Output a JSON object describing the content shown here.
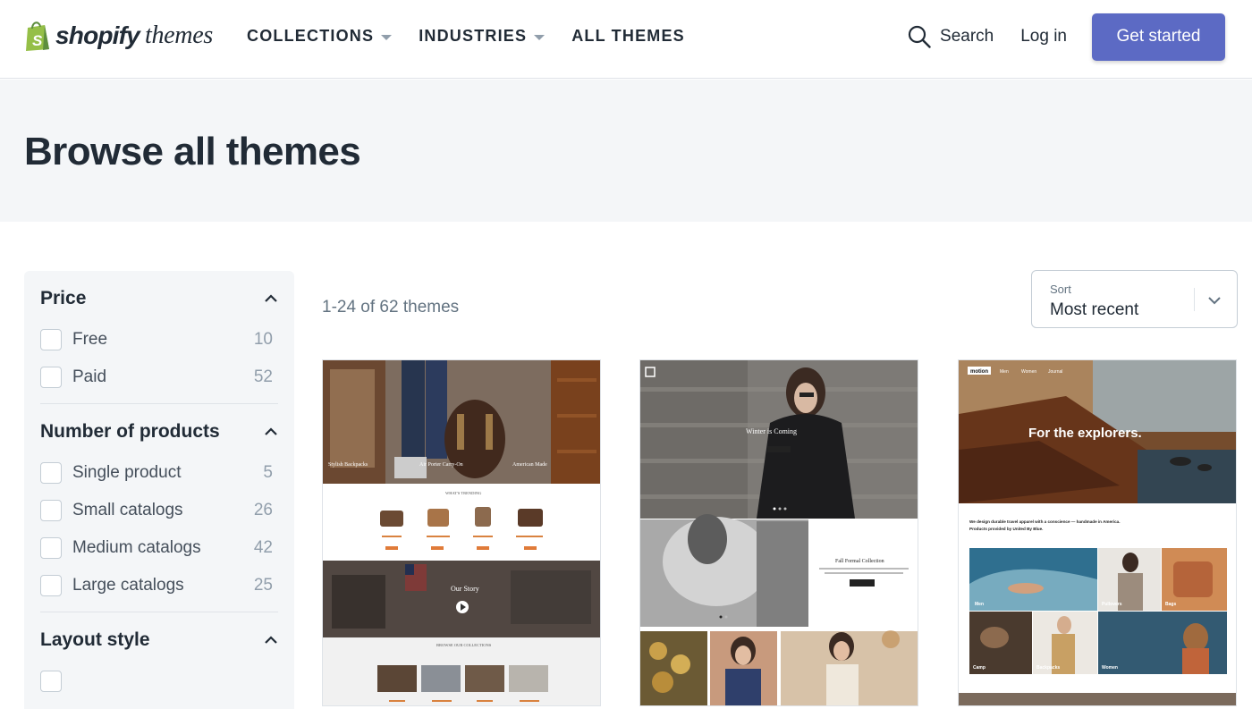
{
  "brand": {
    "logo_word": "shopify",
    "logo_sub": "themes",
    "logo_letter": "S",
    "colors": {
      "logo_green": "#95bf47",
      "accent": "#5c6ac4",
      "text": "#212b36"
    }
  },
  "nav": {
    "links": [
      {
        "label": "COLLECTIONS",
        "has_dropdown": true
      },
      {
        "label": "INDUSTRIES",
        "has_dropdown": true
      },
      {
        "label": "ALL THEMES",
        "has_dropdown": false
      }
    ],
    "search_label": "Search",
    "login_label": "Log in",
    "cta_label": "Get started"
  },
  "hero": {
    "title": "Browse all themes"
  },
  "filters": {
    "groups": [
      {
        "title": "Price",
        "expanded": true,
        "options": [
          {
            "label": "Free",
            "count": "10",
            "checked": false
          },
          {
            "label": "Paid",
            "count": "52",
            "checked": false
          }
        ]
      },
      {
        "title": "Number of products",
        "expanded": true,
        "options": [
          {
            "label": "Single product",
            "count": "5",
            "checked": false
          },
          {
            "label": "Small catalogs",
            "count": "26",
            "checked": false
          },
          {
            "label": "Medium catalogs",
            "count": "42",
            "checked": false
          },
          {
            "label": "Large catalogs",
            "count": "25",
            "checked": false
          }
        ]
      },
      {
        "title": "Layout style",
        "expanded": true,
        "options": []
      }
    ]
  },
  "results": {
    "count_text": "1-24 of 62 themes",
    "sort": {
      "label": "Sort",
      "value": "Most recent"
    }
  },
  "themes": [
    {
      "hero_captions": [
        "Stylish Backpacks",
        "Air Porter Carry-On",
        "American Made"
      ],
      "section_trending": "WHAT'S TRENDING",
      "story_title": "Our Story",
      "section_collections": "BROWSE OUR COLLECTIONS"
    },
    {
      "hero_title": "Winter is Coming",
      "feature_title": "Fall Formal Collection"
    },
    {
      "logo": "motion",
      "nav": [
        "Men",
        "Women",
        "Journal"
      ],
      "hero_title": "For the explorers.",
      "tagline_1": "We design durable travel apparel with a conscience — handmade in America.",
      "tagline_2": "Products provided by United By Blue.",
      "tiles": [
        "Men",
        "Pullovers",
        "Bags",
        "Camp",
        "Backpacks",
        "Women"
      ]
    }
  ]
}
